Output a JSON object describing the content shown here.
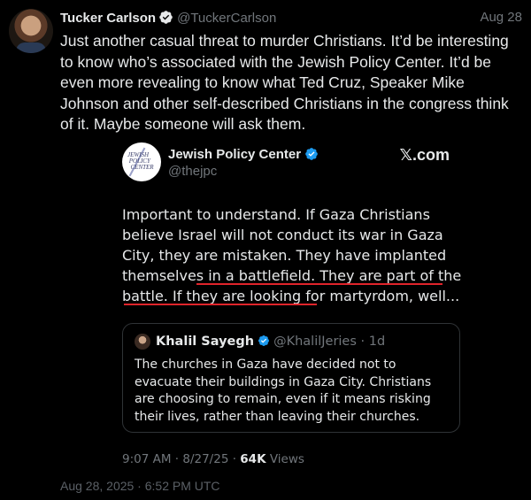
{
  "tweet": {
    "author_name": "Tucker Carlson",
    "author_handle": "@TuckerCarlson",
    "date": "Aug 28",
    "text": "Just another casual threat to murder Christians. It’d be interesting to know who’s associated with the Jewish Policy Center. It’d be even more revealing to know what Ted Cruz, Speaker Mike Johnson and other self-described Christians in the congress think of it. Maybe someone will ask them.",
    "footer_timestamp": "Aug 28, 2025 · 6:52 PM UTC"
  },
  "embed": {
    "logo_text": "JEWISH POLICY CENTER",
    "author_name": "Jewish Policy Center",
    "author_handle": "@thejpc",
    "source_label": "X.com",
    "text_part1": "Important to understand. If Gaza Christians believe Israel will not conduct its war in Gaza City, they are mistaken. They have implanted themselves in a battlefield. ",
    "text_part2": "They are part of the battle. If they are looking for martyrdom, well...",
    "time": "9:07 AM · 8/27/25 · ",
    "views_count": "64K",
    "views_label": " Views"
  },
  "quote": {
    "author_name": "Khalil Sayegh",
    "author_handle": "@KhalilJeries",
    "age": "· 1d",
    "text": "The churches in Gaza have decided not to evacuate their buildings in Gaza City. Christians are choosing to remain, even if it means risking their lives, rather than leaving their churches."
  },
  "colors": {
    "background": "#000000",
    "verified": "#1d9bf0",
    "underline": "#e0242b",
    "muted": "#71767b"
  },
  "icons": [
    "verified-badge-icon",
    "x-logo-icon"
  ]
}
